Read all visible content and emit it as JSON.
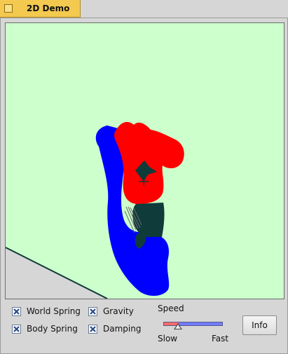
{
  "window": {
    "title": "2D Demo",
    "title_icon": "window-icon"
  },
  "canvas": {
    "background_color": "#ccffcc",
    "softbody_colors": {
      "blue": "#0000ff",
      "red": "#ff0000",
      "dark": "#0f3b3b"
    }
  },
  "controls": {
    "checkboxes": [
      {
        "label": "World Spring",
        "checked": true
      },
      {
        "label": "Gravity",
        "checked": true
      },
      {
        "label": "Body Spring",
        "checked": true
      },
      {
        "label": "Damping",
        "checked": true
      }
    ],
    "speed": {
      "label": "Speed",
      "min_label": "Slow",
      "max_label": "Fast",
      "value_fraction": 0.25
    },
    "info_button": {
      "label": "Info"
    }
  },
  "colors": {
    "tab_accent": "#f3c94f",
    "checkbox_mark": "#2a4a8a"
  }
}
